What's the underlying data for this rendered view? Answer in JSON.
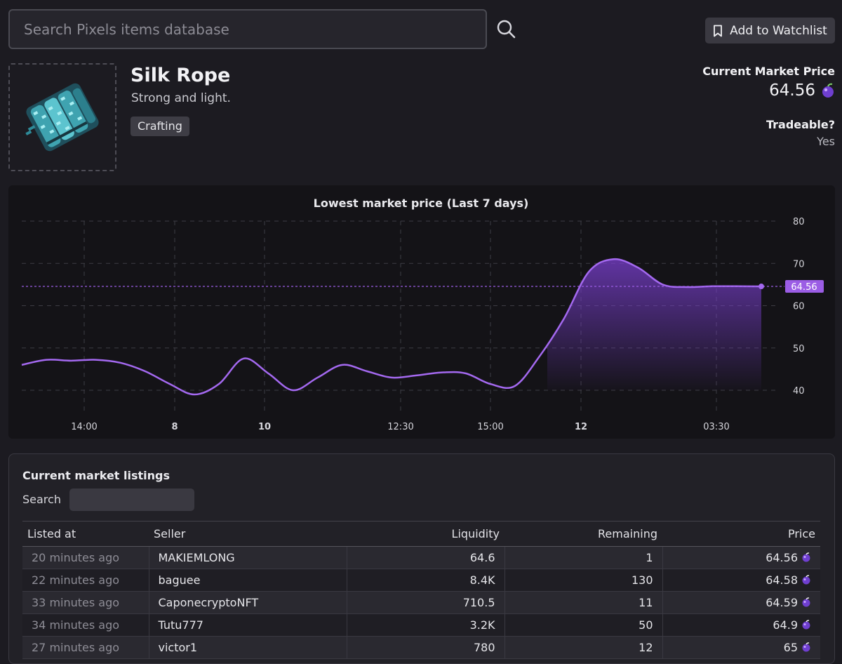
{
  "search": {
    "placeholder": "Search Pixels items database"
  },
  "toolbar": {
    "watchlist_label": "Add to Watchlist"
  },
  "item": {
    "name": "Silk Rope",
    "description": "Strong and light.",
    "tag": "Crafting",
    "image_icon": "silk-rope-icon"
  },
  "market": {
    "price_label": "Current Market Price",
    "price_value": "64.56",
    "currency_icon": "berry-coin-icon",
    "tradeable_label": "Tradeable?",
    "tradeable_value": "Yes"
  },
  "colors": {
    "accent": "#9b5de5",
    "line": "#a469f0",
    "background": "#1c1b21"
  },
  "chart_data": {
    "type": "area",
    "title": "Lowest market price (Last 7 days)",
    "xlabel": "",
    "ylabel": "",
    "ylim": [
      40,
      80
    ],
    "yticks": [
      40,
      50,
      60,
      70,
      80
    ],
    "xticks": [
      {
        "label": "14:00",
        "bold": false
      },
      {
        "label": "8",
        "bold": true
      },
      {
        "label": "10",
        "bold": true
      },
      {
        "label": "12:30",
        "bold": false
      },
      {
        "label": "15:00",
        "bold": false
      },
      {
        "label": "12",
        "bold": true
      },
      {
        "label": "03:30",
        "bold": false
      }
    ],
    "grid": true,
    "current_price_marker": 64.56,
    "series": [
      {
        "points": [
          46.0,
          47.2,
          47.0,
          47.2,
          46.5,
          44.5,
          41.5,
          39.0,
          41.5,
          47.5,
          44.0,
          40.0,
          43.0,
          46.0,
          44.5,
          43.0,
          43.5,
          44.2,
          44.0,
          41.5,
          41.0,
          48.0,
          57.0,
          68.0,
          71.0,
          69.0,
          65.0,
          64.4,
          64.6,
          64.6,
          64.56
        ]
      }
    ]
  },
  "listings": {
    "title": "Current market listings",
    "search_label": "Search",
    "columns": [
      "Listed at",
      "Seller",
      "Liquidity",
      "Remaining",
      "Price"
    ],
    "rows": [
      {
        "listed": "20 minutes ago",
        "seller": "MAKIEMLONG",
        "liquidity": "64.6",
        "remaining": "1",
        "price": "64.56"
      },
      {
        "listed": "22 minutes ago",
        "seller": "baguee",
        "liquidity": "8.4K",
        "remaining": "130",
        "price": "64.58"
      },
      {
        "listed": "33 minutes ago",
        "seller": "CaponecryptoNFT",
        "liquidity": "710.5",
        "remaining": "11",
        "price": "64.59"
      },
      {
        "listed": "34 minutes ago",
        "seller": "Tutu777",
        "liquidity": "3.2K",
        "remaining": "50",
        "price": "64.9"
      },
      {
        "listed": "27 minutes ago",
        "seller": "victor1",
        "liquidity": "780",
        "remaining": "12",
        "price": "65"
      }
    ]
  }
}
